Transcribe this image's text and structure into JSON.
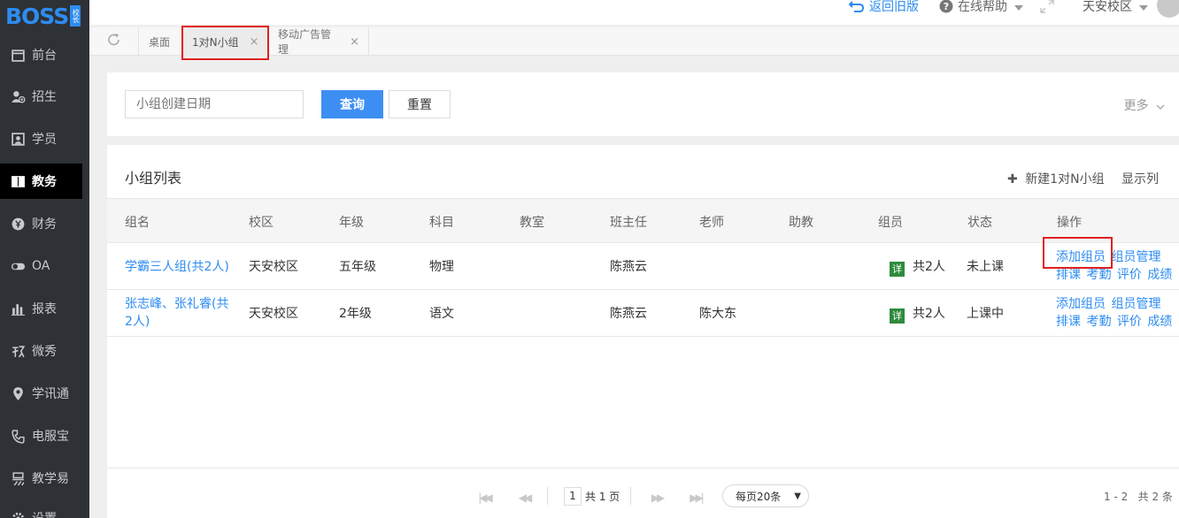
{
  "logo": {
    "text": "BOSS",
    "badge": "校长"
  },
  "sidebar": {
    "items": [
      {
        "label": "前台",
        "icon": "calendar-icon"
      },
      {
        "label": "招生",
        "icon": "add-user-icon"
      },
      {
        "label": "学员",
        "icon": "student-card-icon"
      },
      {
        "label": "教务",
        "icon": "book-icon",
        "active": true
      },
      {
        "label": "财务",
        "icon": "yen-icon"
      },
      {
        "label": "OA",
        "icon": "toggle-icon"
      },
      {
        "label": "报表",
        "icon": "bar-chart-icon"
      },
      {
        "label": "微秀",
        "icon": "weixiu-icon"
      },
      {
        "label": "学讯通",
        "icon": "location-pin-icon"
      },
      {
        "label": "电服宝",
        "icon": "phone-icon"
      },
      {
        "label": "教学易",
        "icon": "teach-icon"
      },
      {
        "label": "设置",
        "icon": "gear-icon"
      }
    ]
  },
  "header": {
    "back_old": "返回旧版",
    "help": "在线帮助",
    "campus": "天安校区"
  },
  "tabs": [
    {
      "label": "桌面",
      "closable": false
    },
    {
      "label": "1对N小组",
      "closable": true,
      "active": true
    },
    {
      "label": "移动广告管理",
      "closable": true
    }
  ],
  "tab_close_glyph": "×",
  "filter": {
    "date_placeholder": "小组创建日期",
    "query_label": "查询",
    "reset_label": "重置",
    "more_label": "更多"
  },
  "list": {
    "title": "小组列表",
    "new_label": "新建1对N小组",
    "show_cols_label": "显示列",
    "columns": [
      "组名",
      "校区",
      "年级",
      "科目",
      "教室",
      "班主任",
      "老师",
      "助教",
      "组员",
      "状态",
      "操作"
    ],
    "rows": [
      {
        "name": "学霸三人组(共2人)",
        "name_lines": [
          "学霸三人组(共2人)"
        ],
        "campus": "天安校区",
        "grade": "五年级",
        "subject": "物理",
        "classroom": "",
        "head_teacher": "陈燕云",
        "teacher": "",
        "assistant": "",
        "members_badge": "详",
        "members": "共2人",
        "status": "未上课",
        "ops": [
          "添加组员",
          "组员管理",
          "排课",
          "考勤",
          "评价",
          "成绩"
        ]
      },
      {
        "name": "张志峰、张礼睿(共2人)",
        "name_lines": [
          "张志峰、张礼睿(共",
          "2人)"
        ],
        "campus": "天安校区",
        "grade": "2年级",
        "subject": "语文",
        "classroom": "",
        "head_teacher": "陈燕云",
        "teacher": "陈大东",
        "assistant": "",
        "members_badge": "详",
        "members": "共2人",
        "status": "上课中",
        "ops": [
          "添加组员",
          "组员管理",
          "排课",
          "考勤",
          "评价",
          "成绩"
        ]
      }
    ]
  },
  "pager": {
    "page": "1",
    "total_pages_text": "共 1 页",
    "page_size": "每页20条",
    "range_text": "1 - 2   共 2 条"
  },
  "colors": {
    "sidebar_bg": "#2e3135",
    "accent": "#2d8cf0",
    "highlight_box": "#e02020"
  }
}
